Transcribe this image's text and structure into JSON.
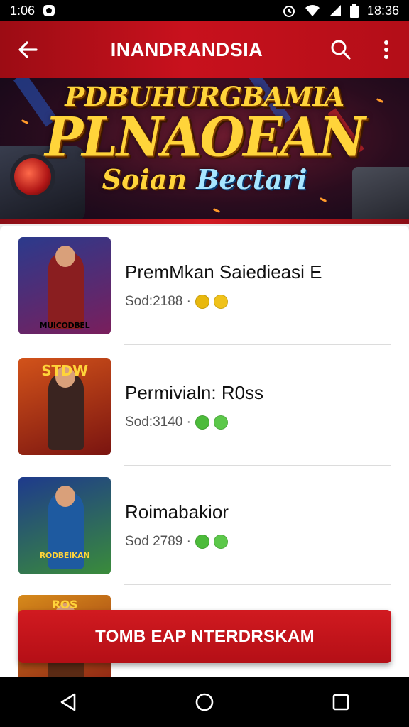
{
  "status_bar": {
    "time_left": "1:06",
    "time_right": "18:36"
  },
  "app_bar": {
    "title": "INANDRANDSIA"
  },
  "banner": {
    "line1": "PDBUHURGBAMIA",
    "line2": "PLNAOEAN",
    "sub_part1": "Soian",
    "sub_part2": "Bectari"
  },
  "games": [
    {
      "name": "PremMkan Saiedieasi E",
      "meta": "Sod:2188 ·",
      "thumb_label": "MUICODBEL",
      "badge_colors": [
        "#e8b80e",
        "#f0c21a"
      ],
      "thumb_bg": [
        "#2b3a8c",
        "#7a1e5c"
      ],
      "hero_color": "#8a1e20"
    },
    {
      "name": "Permivialn: R0ss",
      "meta": "Sod:3140 ·",
      "thumb_label": "STDW",
      "badge_colors": [
        "#4cbb3a",
        "#5cc84a"
      ],
      "thumb_bg": [
        "#d2531a",
        "#7a1410"
      ],
      "hero_color": "#3a2420"
    },
    {
      "name": "Roimabakior",
      "meta": "Sod 2789 ·",
      "thumb_label": "RODBEIKAN",
      "badge_colors": [
        "#4cbb3a",
        "#5cc84a"
      ],
      "thumb_bg": [
        "#1e3a8c",
        "#3a8c3a"
      ],
      "hero_color": "#1e5aa0"
    },
    {
      "name": "",
      "meta": "",
      "thumb_label": "ROS",
      "badge_colors": [],
      "thumb_bg": [
        "#d68a1a",
        "#8a1e14"
      ],
      "hero_color": "#5a2a14"
    }
  ],
  "cta": {
    "label": "TOMB EAP NTERDRSKAM"
  },
  "colors": {
    "app_bar_red": "#c8111d",
    "cta_red": "#c4141a",
    "banner_gold": "#ffd43a"
  }
}
